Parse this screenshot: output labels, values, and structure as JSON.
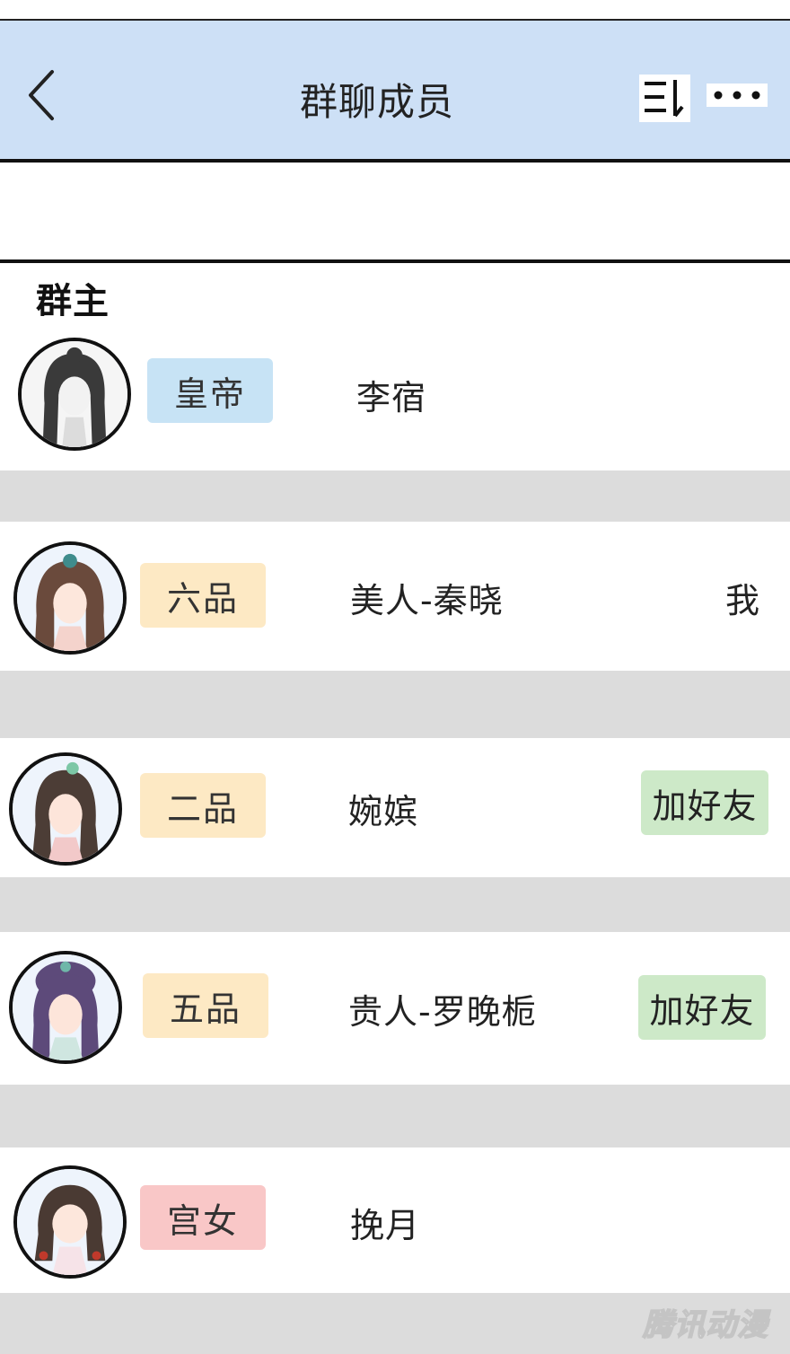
{
  "header": {
    "title": "群聊成员",
    "back_icon": "chevron-left-icon",
    "sort_icon": "sort-icon",
    "more_icon": "more-icon"
  },
  "section": {
    "title": "群主"
  },
  "members": [
    {
      "rank": "皇帝",
      "name": "李宿",
      "rank_color": "#c7e3f5",
      "hair": "#3a3a3a",
      "skin": "#f2f2f2",
      "bg": "#f5f5f5"
    },
    {
      "rank": "六品",
      "name": "美人-秦晓",
      "tag": "我",
      "rank_color": "#fde9c4",
      "hair": "#6a4a3c",
      "skin": "#fde7dc",
      "bg": "#eef4fc"
    },
    {
      "rank": "二品",
      "name": "婉嫔",
      "action": "加好友",
      "rank_color": "#fde9c4",
      "hair": "#4c3d36",
      "skin": "#fde5da",
      "bg": "#eef4fc"
    },
    {
      "rank": "五品",
      "name": "贵人-罗晚栀",
      "action": "加好友",
      "rank_color": "#fde9c4",
      "hair": "#5d4a7a",
      "skin": "#fde5da",
      "bg": "#eef4fc"
    },
    {
      "rank": "宫女",
      "name": "挽月",
      "rank_color": "#f9c7c7",
      "hair": "#4a3a33",
      "skin": "#fde7dc",
      "bg": "#eef4fc"
    }
  ],
  "colors": {
    "header_bg": "#cde0f6",
    "separator": "#dcdcdc",
    "add_friend_bg": "#cde9c8"
  },
  "watermark": "腾讯动漫"
}
